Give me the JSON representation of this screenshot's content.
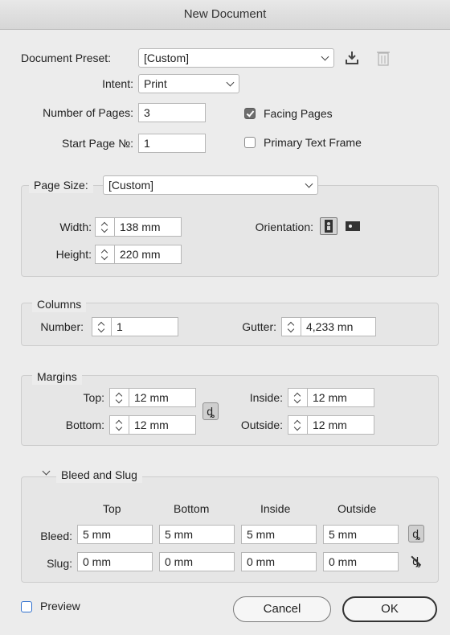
{
  "window": {
    "title": "New Document"
  },
  "preset": {
    "label": "Document Preset:",
    "value": "[Custom]",
    "save_icon": "download-icon",
    "delete_icon": "trash-icon"
  },
  "intent": {
    "label": "Intent:",
    "value": "Print"
  },
  "pages": {
    "label": "Number of Pages:",
    "value": "3"
  },
  "start_page": {
    "label": "Start Page №:",
    "value": "1"
  },
  "facing_pages": {
    "label": "Facing Pages",
    "checked": true
  },
  "primary_text_frame": {
    "label": "Primary Text Frame",
    "checked": false
  },
  "page_size": {
    "label": "Page Size:",
    "value": "[Custom]",
    "width_label": "Width:",
    "width": "138 mm",
    "height_label": "Height:",
    "height": "220 mm",
    "orientation_label": "Orientation:",
    "orientation": "portrait"
  },
  "columns": {
    "title": "Columns",
    "number_label": "Number:",
    "number": "1",
    "gutter_label": "Gutter:",
    "gutter": "4,233 mn"
  },
  "margins": {
    "title": "Margins",
    "top_label": "Top:",
    "top": "12 mm",
    "bottom_label": "Bottom:",
    "bottom": "12 mm",
    "inside_label": "Inside:",
    "inside": "12 mm",
    "outside_label": "Outside:",
    "outside": "12 mm",
    "link_icon": "ȡ"
  },
  "bleed_slug": {
    "title": "Bleed and Slug",
    "col_top": "Top",
    "col_bottom": "Bottom",
    "col_inside": "Inside",
    "col_outside": "Outside",
    "bleed_label": "Bleed:",
    "bleed": [
      "5 mm",
      "5 mm",
      "5 mm",
      "5 mm"
    ],
    "slug_label": "Slug:",
    "slug": [
      "0 mm",
      "0 mm",
      "0 mm",
      "0 mm"
    ],
    "link_icon": "ȡ",
    "unlink_icon": "ȡ"
  },
  "preview": {
    "label": "Preview",
    "checked": false
  },
  "buttons": {
    "cancel": "Cancel",
    "ok": "OK"
  }
}
